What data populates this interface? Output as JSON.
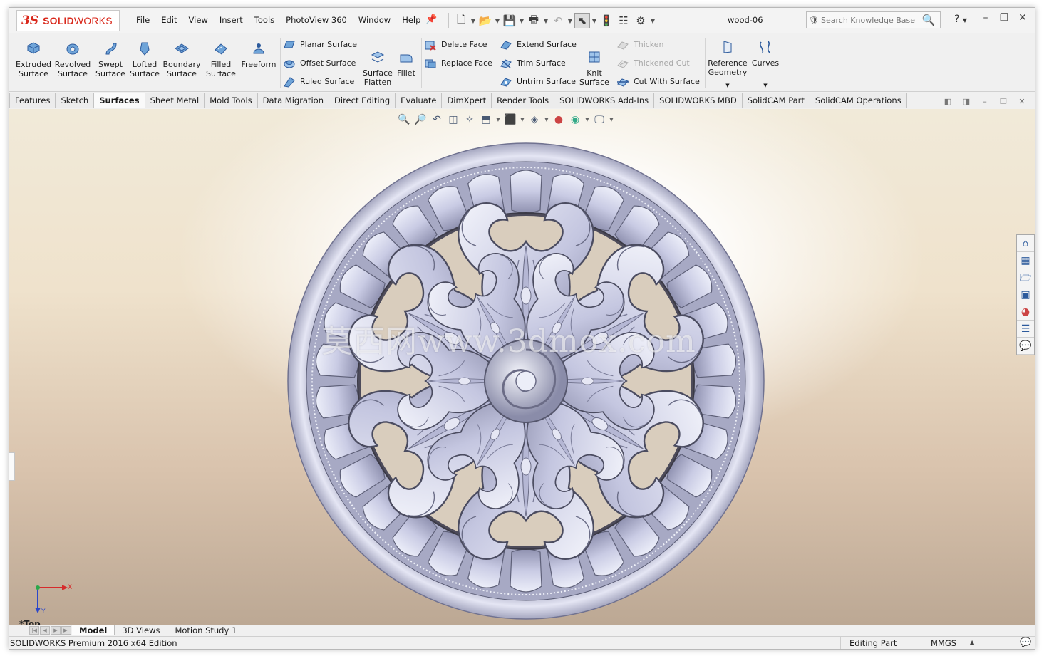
{
  "app": {
    "brand_ds": "3S",
    "brand_bold": "SOLID",
    "brand_rest": "WORKS",
    "document": "wood-06"
  },
  "menu": [
    "File",
    "Edit",
    "View",
    "Insert",
    "Tools",
    "PhotoView 360",
    "Window",
    "Help"
  ],
  "search": {
    "placeholder": "Search Knowledge Base"
  },
  "help_label": "?",
  "ribbon": {
    "big": [
      {
        "label1": "Extruded",
        "label2": "Surface"
      },
      {
        "label1": "Revolved",
        "label2": "Surface"
      },
      {
        "label1": "Swept",
        "label2": "Surface"
      },
      {
        "label1": "Lofted",
        "label2": "Surface"
      },
      {
        "label1": "Boundary",
        "label2": "Surface"
      },
      {
        "label1": "Filled",
        "label2": "Surface"
      },
      {
        "label1": "Freeform",
        "label2": ""
      }
    ],
    "group2": [
      "Planar Surface",
      "Offset Surface",
      "Ruled Surface"
    ],
    "flatten": {
      "label1": "Surface",
      "label2": "Flatten"
    },
    "fillet": "Fillet",
    "group3": [
      "Delete Face",
      "Replace Face"
    ],
    "group4": [
      "Extend Surface",
      "Trim Surface",
      "Untrim Surface"
    ],
    "knit": {
      "label1": "Knit",
      "label2": "Surface"
    },
    "group5": [
      "Thicken",
      "Thickened Cut",
      "Cut With Surface"
    ],
    "refgeo": {
      "label1": "Reference",
      "label2": "Geometry"
    },
    "curves": "Curves"
  },
  "tabs": [
    "Features",
    "Sketch",
    "Surfaces",
    "Sheet Metal",
    "Mold Tools",
    "Data Migration",
    "Direct Editing",
    "Evaluate",
    "DimXpert",
    "Render Tools",
    "SOLIDWORKS Add-Ins",
    "SOLIDWORKS MBD",
    "SolidCAM Part",
    "SolidCAM Operations"
  ],
  "active_tab": "Surfaces",
  "viewport": {
    "watermark": "莫西网www.3dmox.com",
    "view_name": "*Top",
    "axis_x": "X",
    "axis_y": "Y"
  },
  "bottom_tabs": [
    "Model",
    "3D Views",
    "Motion Study 1"
  ],
  "status": {
    "edition": "SOLIDWORKS Premium 2016 x64 Edition",
    "mode": "Editing Part",
    "units": "MMGS"
  },
  "colors": {
    "brand_red": "#d9291c",
    "model_fill": "#c9cbe4",
    "model_shadow": "#6b6b86",
    "accent_blue": "#2c5a9c"
  }
}
